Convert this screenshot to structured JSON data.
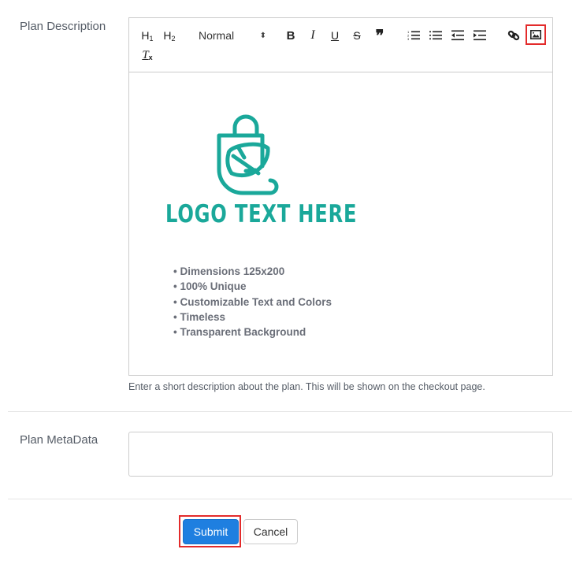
{
  "form": {
    "description": {
      "label": "Plan Description",
      "help_text": "Enter a short description about the plan. This will be shown on the checkout page."
    },
    "metadata": {
      "label": "Plan MetaData",
      "value": "",
      "placeholder": ""
    }
  },
  "editor": {
    "toolbar": {
      "h1": {
        "letter": "H",
        "sub": "1",
        "icon": "header-1-icon"
      },
      "h2": {
        "letter": "H",
        "sub": "2",
        "icon": "header-2-icon"
      },
      "format_select": {
        "value": "Normal",
        "caret": "⬍"
      },
      "bold": "B",
      "italic": "I",
      "underline": "U",
      "strike": "S",
      "blockquote": "❞",
      "ordered_list": "ordered-list-icon",
      "bullet_list": "bullet-list-icon",
      "outdent": "outdent-icon",
      "indent": "indent-icon",
      "link": "link-icon",
      "image": "image-icon",
      "clean": {
        "letter": "T",
        "sub": "x"
      }
    },
    "content": {
      "logo_text": "LOGO TEXT HERE",
      "logo_color": "#1aa89a",
      "bullets": [
        "Dimensions 125x200",
        "100% Unique",
        "Customizable Text and Colors",
        "Timeless",
        "Transparent Background"
      ]
    }
  },
  "actions": {
    "submit": "Submit",
    "cancel": "Cancel"
  },
  "colors": {
    "primary": "#1f7fe0",
    "highlight": "#e32b2b"
  }
}
